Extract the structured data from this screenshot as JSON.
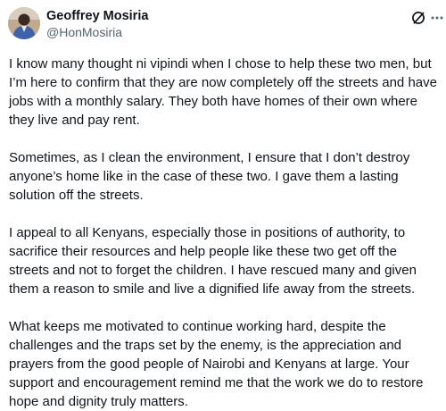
{
  "author": {
    "name": "Geoffrey Mosiria",
    "handle": "@HonMosiria"
  },
  "icons": {
    "grok": "grok-icon",
    "more": "more-options-icon"
  },
  "paragraphs": [
    "I know many thought ni vipindi when I chose to help these two men, but\nI’m here to confirm that they are now completely off the streets and have\njobs with a monthly salary. They both have homes of their own where\nthey live and pay rent.",
    "Sometimes, as I clean the environment, I ensure that I don’t destroy\nanyone’s home  like in the case of these two. I gave them a lasting\nsolution off the streets.",
    "I appeal to all Kenyans, especially those in positions of authority, to\nsacrifice their resources and help people like these two get off the\nstreets and not to forget the children. I have rescued many and given\nthem a reason to smile and live a dignified life away from the streets.",
    "What keeps me motivated to continue working hard, despite the\nchallenges and the traps set by the enemy, is the appreciation and\nprayers from the good people of Nairobi and Kenyans at large. Your\nsupport and encouragement remind me that the work we do to restore\nhope and dignity truly matters."
  ]
}
